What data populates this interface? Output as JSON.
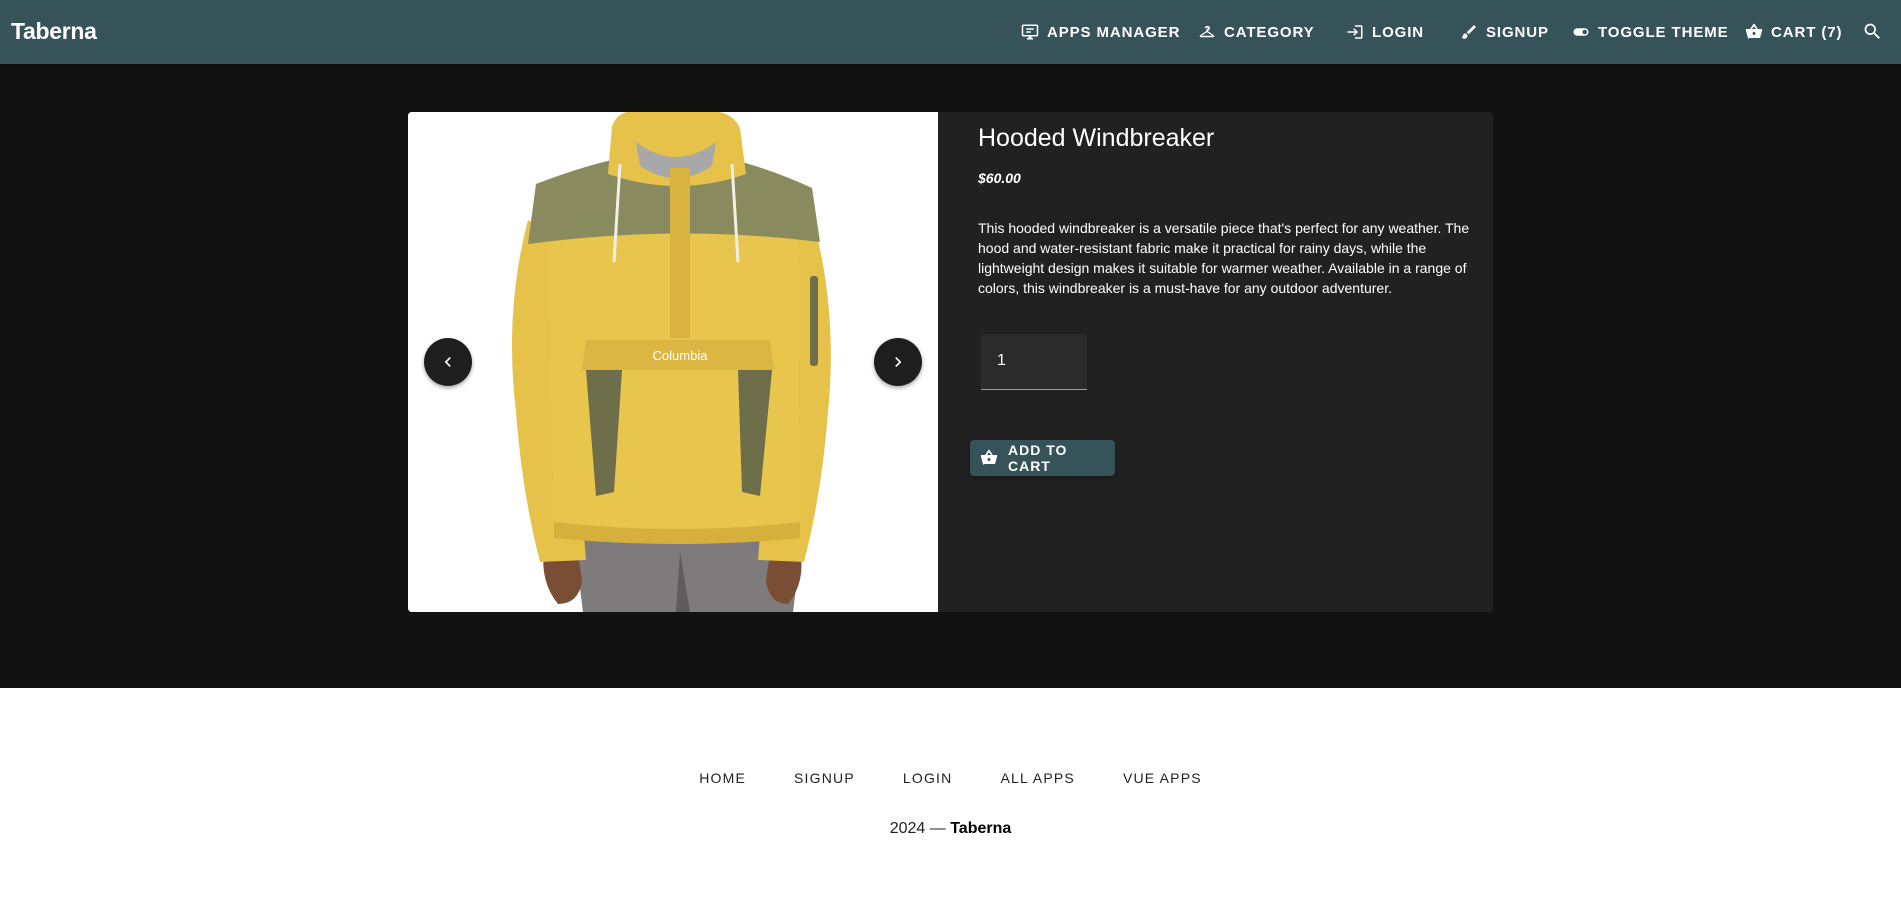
{
  "app": {
    "brand": "Taberna"
  },
  "nav": {
    "apps_manager": "APPS MANAGER",
    "category": "CATEGORY",
    "login": "LOGIN",
    "signup": "SIGNUP",
    "toggle_theme": "TOGGLE THEME",
    "cart": "CART (7)",
    "search_icon": "search-icon"
  },
  "product": {
    "title": "Hooded Windbreaker",
    "price": "$60.00",
    "description": "This hooded windbreaker is a versatile piece that's perfect for any weather. The hood and water-resistant fabric make it practical for rainy days, while the lightweight design makes it suitable for warmer weather. Available in a range of colors, this windbreaker is a must-have for any outdoor adventurer.",
    "image_logo_text": "Columbia",
    "quantity": "1",
    "add_to_cart": "ADD TO CART"
  },
  "footer": {
    "links": [
      "HOME",
      "SIGNUP",
      "LOGIN",
      "ALL APPS",
      "VUE APPS"
    ],
    "year": "2024",
    "separator": "—",
    "brand": "Taberna"
  },
  "colors": {
    "topbar": "#37535a",
    "main_bg": "#121212",
    "card_bg": "#212121",
    "button": "#37535a",
    "jacket_yellow": "#e6c24a",
    "jacket_olive": "#8a8a5c"
  }
}
